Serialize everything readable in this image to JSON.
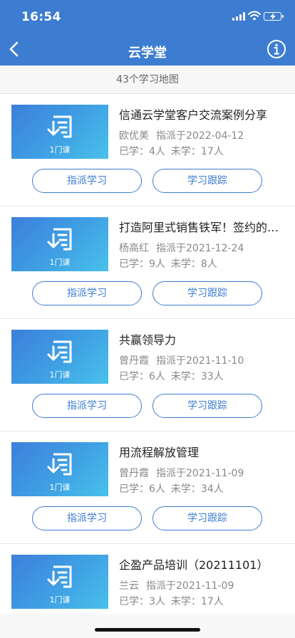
{
  "status_bar": {
    "time": "16:54"
  },
  "nav": {
    "title": "云学堂"
  },
  "summary": {
    "count_label": "43个学习地图"
  },
  "cards": [
    {
      "lesson_label": "1门课",
      "title": "信通云学堂客户交流案例分享",
      "owner": "欧优美",
      "assigned": "指派于2022-04-12",
      "learned": "已学：4人",
      "unlearned": "未学：17人",
      "assign_label": "指派学习",
      "track_label": "学习跟踪"
    },
    {
      "lesson_label": "1门课",
      "title": "打造阿里式销售铁军！签约的…",
      "owner": "杨高红",
      "assigned": "指派于2021-12-24",
      "learned": "已学：9人",
      "unlearned": "未学：8人",
      "assign_label": "指派学习",
      "track_label": "学习跟踪"
    },
    {
      "lesson_label": "1门课",
      "title": "共赢领导力",
      "owner": "曾丹霞",
      "assigned": "指派于2021-11-10",
      "learned": "已学：6人",
      "unlearned": "未学：33人",
      "assign_label": "指派学习",
      "track_label": "学习跟踪"
    },
    {
      "lesson_label": "1门课",
      "title": "用流程解放管理",
      "owner": "曾丹霞",
      "assigned": "指派于2021-11-09",
      "learned": "已学：6人",
      "unlearned": "未学：34人",
      "assign_label": "指派学习",
      "track_label": "学习跟踪"
    },
    {
      "lesson_label": "1门课",
      "title": "企盈产品培训（20211101）",
      "owner": "兰云",
      "assigned": "指派于2021-11-09",
      "learned": "已学：3人",
      "unlearned": "未学：17人",
      "assign_label": "指派学习",
      "track_label": "学习跟踪"
    }
  ],
  "colors": {
    "header": "#3d7dd1",
    "accent": "#3d7dd1",
    "battery": "#4cd964"
  },
  "icons": [
    "signal-icon",
    "wifi-icon",
    "battery-icon",
    "back-arrow-icon",
    "info-icon",
    "document-download-icon"
  ]
}
